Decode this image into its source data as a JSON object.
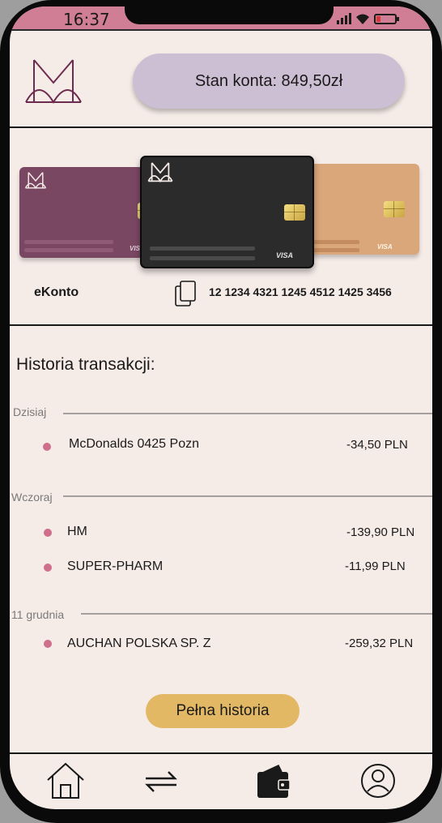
{
  "status_bar": {
    "time": "16:37"
  },
  "header": {
    "balance_label": "Stan konta: 849,50zł"
  },
  "cards": [
    {
      "color": "#7a4763",
      "brand": "VISA"
    },
    {
      "color": "#2b2b2b",
      "brand": "VISA"
    },
    {
      "color": "#d9a77a",
      "brand": "VISA"
    }
  ],
  "account": {
    "name": "eKonto",
    "number": "12 1234 4321 1245 4512 1425 3456"
  },
  "history": {
    "title": "Historia transakcji:",
    "groups": [
      {
        "label": "Dzisiaj",
        "transactions": [
          {
            "name": "McDonalds 0425 Pozn",
            "amount": "-34,50 PLN"
          }
        ]
      },
      {
        "label": "Wczoraj",
        "transactions": [
          {
            "name": "HM",
            "amount": "-139,90 PLN"
          },
          {
            "name": "SUPER-PHARM",
            "amount": "-11,99 PLN"
          }
        ]
      },
      {
        "label": "11 grudnia",
        "transactions": [
          {
            "name": "AUCHAN POLSKA SP. Z",
            "amount": "-259,32 PLN"
          }
        ]
      }
    ],
    "full_history_label": "Pełna historia"
  },
  "nav": [
    {
      "icon": "home-icon"
    },
    {
      "icon": "transfer-icon"
    },
    {
      "icon": "wallet-icon"
    },
    {
      "icon": "profile-icon"
    }
  ],
  "colors": {
    "accent_pink": "#cf7e96",
    "background": "#f5ebe7",
    "balance_pill": "#cdbfd3",
    "button_gold": "#e3b865",
    "dot": "#cf6f8c"
  }
}
